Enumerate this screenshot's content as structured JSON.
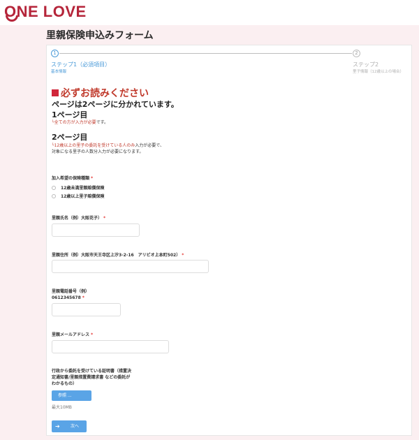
{
  "brand": {
    "logo": "ONE LOVE",
    "color": "#b5253a"
  },
  "page": {
    "title": "里親保険申込みフォーム"
  },
  "stepper": {
    "step1": {
      "number": "1",
      "label": "ステップ1（必須項目）",
      "sub": "基本情報"
    },
    "step2": {
      "number": "2",
      "label": "ステップ2",
      "sub": "里子情報（12歳以上の場合）"
    }
  },
  "notice": {
    "heading": "必ずお読みください",
    "line1": "ページは2ページに分かれています。",
    "page1_title": "1ページ目",
    "page1_red": "└全ての方が入力が必要",
    "page1_tail": "です。",
    "page2_title": "2ページ目",
    "page2_red": "└12歳以上の里子の委託を受けている人のみ",
    "page2_tail": "入力が必要で、",
    "page2_line2": "対象になる里子の人数分入力が必要になります。"
  },
  "fields": {
    "plan": {
      "label": "加入希望の保険種類",
      "options": [
        "12歳未満里親賠償保険",
        "12歳以上里子賠償保険"
      ]
    },
    "name": {
      "label": "里親氏名（例）大阪花子）"
    },
    "address": {
      "label": "里親住所（例）大阪市天王寺区上汐3-2-16　アリビオ上本町502）"
    },
    "phone": {
      "label1": "里親電話番号（例）",
      "label2": "0612345678"
    },
    "email": {
      "label": "里親メールアドレス"
    },
    "certificate": {
      "label1": "行政から委託を受けている証明書（措置決",
      "label2": "定通知書/里親措置費請求書 などの委託が",
      "label3": "わかるもの）",
      "button": "参照 ...",
      "max": "最大10MB"
    }
  },
  "required_mark": "*",
  "next_button": {
    "icon": "arrow-right-icon",
    "label": "次へ"
  }
}
